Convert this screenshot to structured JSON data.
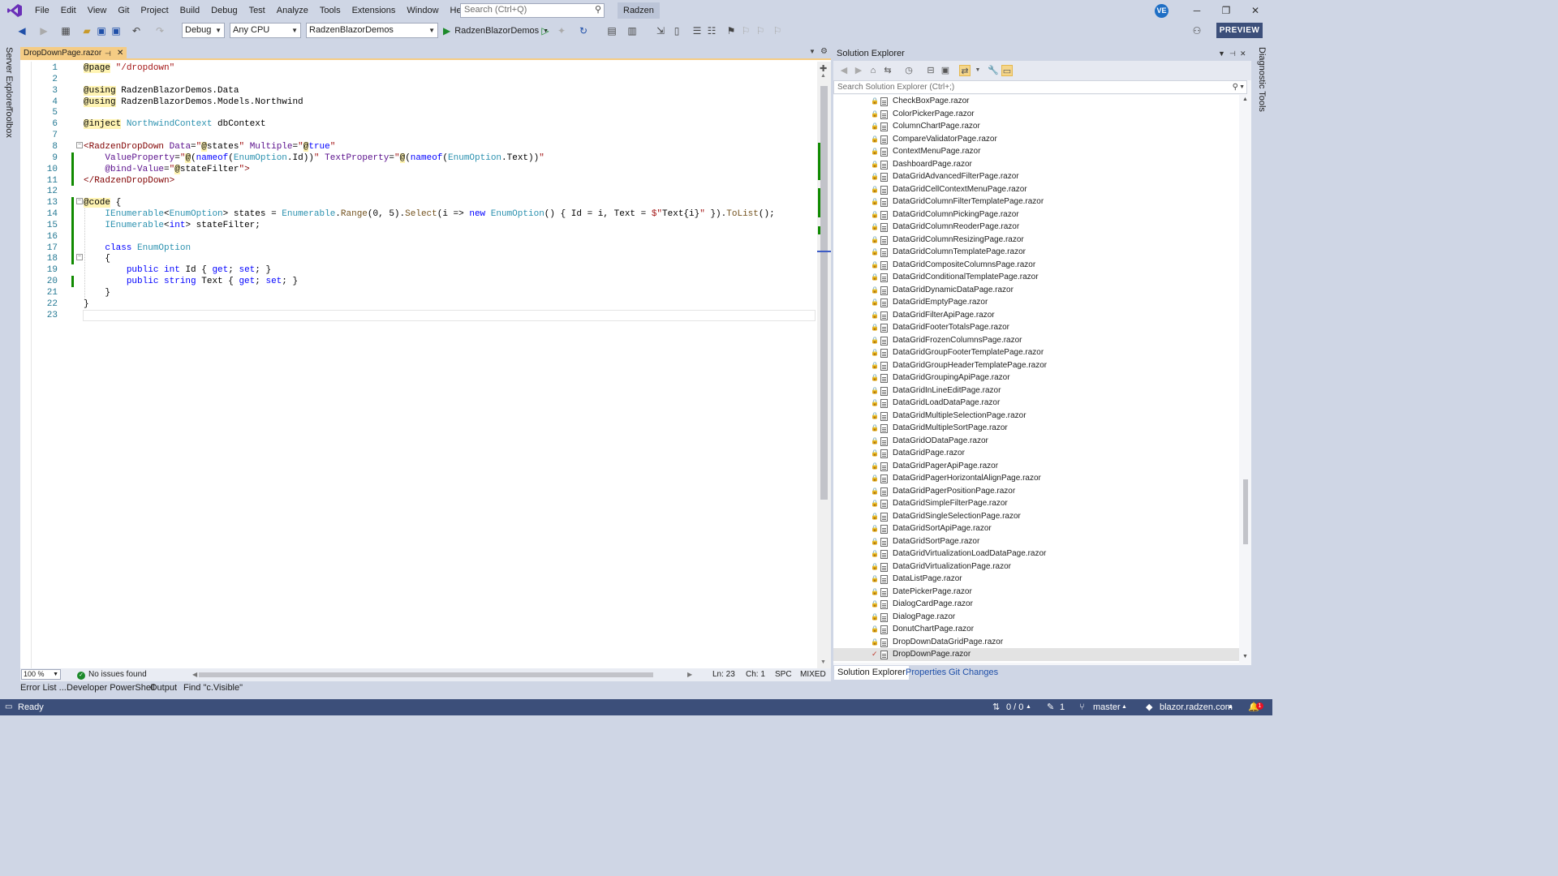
{
  "menubar": {
    "items": [
      "File",
      "Edit",
      "View",
      "Git",
      "Project",
      "Build",
      "Debug",
      "Test",
      "Analyze",
      "Tools",
      "Extensions",
      "Window",
      "Help"
    ],
    "search_placeholder": "Search (Ctrl+Q)",
    "solution_name": "Radzen",
    "user_initials": "VE"
  },
  "toolbar": {
    "configuration": "Debug",
    "platform": "Any CPU",
    "startup_project": "RadzenBlazorDemos",
    "run_label": "RadzenBlazorDemos",
    "preview_label": "PREVIEW"
  },
  "left_rail": {
    "tabs": [
      "Server Explorer",
      "Toolbox"
    ]
  },
  "right_rail": {
    "tabs": [
      "Diagnostic Tools"
    ]
  },
  "editor": {
    "tab_title": "DropDownPage.razor",
    "line_numbers": [
      "1",
      "2",
      "3",
      "4",
      "5",
      "6",
      "7",
      "8",
      "9",
      "10",
      "11",
      "12",
      "13",
      "14",
      "15",
      "16",
      "17",
      "18",
      "19",
      "20",
      "21",
      "22",
      "23"
    ],
    "lines": [
      [
        [
          "c-razor",
          "@page"
        ],
        [
          "c-plain",
          " "
        ],
        [
          "c-str",
          "\"/dropdown\""
        ]
      ],
      [],
      [
        [
          "c-razor",
          "@using"
        ],
        [
          "c-plain",
          " RadzenBlazorDemos.Data"
        ]
      ],
      [
        [
          "c-razor",
          "@using"
        ],
        [
          "c-plain",
          " RadzenBlazorDemos.Models.Northwind"
        ]
      ],
      [],
      [
        [
          "c-razor",
          "@inject"
        ],
        [
          "c-plain",
          " "
        ],
        [
          "c-type",
          "NorthwindContext"
        ],
        [
          "c-plain",
          " dbContext"
        ]
      ],
      [],
      [
        [
          "c-tag",
          "<RadzenDropDown"
        ],
        [
          "c-plain",
          " "
        ],
        [
          "c-attr",
          "Data"
        ],
        [
          "c-plain",
          "="
        ],
        [
          "c-str",
          "\""
        ],
        [
          "c-razor",
          "@"
        ],
        [
          "c-plain",
          "states"
        ],
        [
          "c-str",
          "\""
        ],
        [
          "c-plain",
          " "
        ],
        [
          "c-attr",
          "Multiple"
        ],
        [
          "c-plain",
          "="
        ],
        [
          "c-str",
          "\""
        ],
        [
          "c-razor",
          "@"
        ],
        [
          "c-kw",
          "true"
        ],
        [
          "c-str",
          "\""
        ]
      ],
      [
        [
          "c-plain",
          "    "
        ],
        [
          "c-attr",
          "ValueProperty"
        ],
        [
          "c-plain",
          "="
        ],
        [
          "c-str",
          "\""
        ],
        [
          "c-razor",
          "@"
        ],
        [
          "c-plain",
          "("
        ],
        [
          "c-kw",
          "nameof"
        ],
        [
          "c-plain",
          "("
        ],
        [
          "c-type",
          "EnumOption"
        ],
        [
          "c-plain",
          ".Id))"
        ],
        [
          "c-str",
          "\""
        ],
        [
          "c-plain",
          " "
        ],
        [
          "c-attr",
          "TextProperty"
        ],
        [
          "c-plain",
          "="
        ],
        [
          "c-str",
          "\""
        ],
        [
          "c-razor",
          "@"
        ],
        [
          "c-plain",
          "("
        ],
        [
          "c-kw",
          "nameof"
        ],
        [
          "c-plain",
          "("
        ],
        [
          "c-type",
          "EnumOption"
        ],
        [
          "c-plain",
          ".Text))"
        ],
        [
          "c-str",
          "\""
        ]
      ],
      [
        [
          "c-plain",
          "    "
        ],
        [
          "c-attr",
          "@bind-Value"
        ],
        [
          "c-plain",
          "="
        ],
        [
          "c-str",
          "\""
        ],
        [
          "c-razor",
          "@"
        ],
        [
          "c-plain",
          "stateFilter"
        ],
        [
          "c-str",
          "\""
        ],
        [
          "c-tag",
          ">"
        ]
      ],
      [
        [
          "c-tag",
          "</RadzenDropDown>"
        ]
      ],
      [],
      [
        [
          "c-razor",
          "@code"
        ],
        [
          "c-plain",
          " {"
        ]
      ],
      [
        [
          "c-plain",
          "    "
        ],
        [
          "c-type",
          "IEnumerable"
        ],
        [
          "c-plain",
          "<"
        ],
        [
          "c-type",
          "EnumOption"
        ],
        [
          "c-plain",
          "> states = "
        ],
        [
          "c-type",
          "Enumerable"
        ],
        [
          "c-plain",
          "."
        ],
        [
          "c-meth",
          "Range"
        ],
        [
          "c-plain",
          "(0, 5)."
        ],
        [
          "c-meth",
          "Select"
        ],
        [
          "c-plain",
          "(i => "
        ],
        [
          "c-kw",
          "new"
        ],
        [
          "c-plain",
          " "
        ],
        [
          "c-type",
          "EnumOption"
        ],
        [
          "c-plain",
          "() { Id = i, Text = "
        ],
        [
          "c-str",
          "$\""
        ],
        [
          "c-plain",
          "Text{i}"
        ],
        [
          "c-str",
          "\""
        ],
        [
          "c-plain",
          " })."
        ],
        [
          "c-meth",
          "ToList"
        ],
        [
          "c-plain",
          "();"
        ]
      ],
      [
        [
          "c-plain",
          "    "
        ],
        [
          "c-type",
          "IEnumerable"
        ],
        [
          "c-plain",
          "<"
        ],
        [
          "c-kw",
          "int"
        ],
        [
          "c-plain",
          "> stateFilter;"
        ]
      ],
      [],
      [
        [
          "c-plain",
          "    "
        ],
        [
          "c-kw",
          "class"
        ],
        [
          "c-plain",
          " "
        ],
        [
          "c-type",
          "EnumOption"
        ]
      ],
      [
        [
          "c-plain",
          "    {"
        ]
      ],
      [
        [
          "c-plain",
          "        "
        ],
        [
          "c-kw",
          "public"
        ],
        [
          "c-plain",
          " "
        ],
        [
          "c-kw",
          "int"
        ],
        [
          "c-plain",
          " Id { "
        ],
        [
          "c-kw",
          "get"
        ],
        [
          "c-plain",
          "; "
        ],
        [
          "c-kw",
          "set"
        ],
        [
          "c-plain",
          "; }"
        ]
      ],
      [
        [
          "c-plain",
          "        "
        ],
        [
          "c-kw",
          "public"
        ],
        [
          "c-plain",
          " "
        ],
        [
          "c-kw",
          "string"
        ],
        [
          "c-plain",
          " Text { "
        ],
        [
          "c-kw",
          "get"
        ],
        [
          "c-plain",
          "; "
        ],
        [
          "c-kw",
          "set"
        ],
        [
          "c-plain",
          "; }"
        ]
      ],
      [
        [
          "c-plain",
          "    }"
        ]
      ],
      [
        [
          "c-plain",
          "}"
        ]
      ],
      []
    ],
    "zoom": "100 %",
    "issues": "No issues found",
    "ln": "Ln: 23",
    "ch": "Ch: 1",
    "spc": "SPC",
    "eol": "MIXED"
  },
  "solution_explorer": {
    "title": "Solution Explorer",
    "search_placeholder": "Search Solution Explorer (Ctrl+;)",
    "files": [
      "CheckBoxPage.razor",
      "ColorPickerPage.razor",
      "ColumnChartPage.razor",
      "CompareValidatorPage.razor",
      "ContextMenuPage.razor",
      "DashboardPage.razor",
      "DataGridAdvancedFilterPage.razor",
      "DataGridCellContextMenuPage.razor",
      "DataGridColumnFilterTemplatePage.razor",
      "DataGridColumnPickingPage.razor",
      "DataGridColumnReoderPage.razor",
      "DataGridColumnResizingPage.razor",
      "DataGridColumnTemplatePage.razor",
      "DataGridCompositeColumnsPage.razor",
      "DataGridConditionalTemplatePage.razor",
      "DataGridDynamicDataPage.razor",
      "DataGridEmptyPage.razor",
      "DataGridFilterApiPage.razor",
      "DataGridFooterTotalsPage.razor",
      "DataGridFrozenColumnsPage.razor",
      "DataGridGroupFooterTemplatePage.razor",
      "DataGridGroupHeaderTemplatePage.razor",
      "DataGridGroupingApiPage.razor",
      "DataGridInLineEditPage.razor",
      "DataGridLoadDataPage.razor",
      "DataGridMultipleSelectionPage.razor",
      "DataGridMultipleSortPage.razor",
      "DataGridODataPage.razor",
      "DataGridPage.razor",
      "DataGridPagerApiPage.razor",
      "DataGridPagerHorizontalAlignPage.razor",
      "DataGridPagerPositionPage.razor",
      "DataGridSimpleFilterPage.razor",
      "DataGridSingleSelectionPage.razor",
      "DataGridSortApiPage.razor",
      "DataGridSortPage.razor",
      "DataGridVirtualizationLoadDataPage.razor",
      "DataGridVirtualizationPage.razor",
      "DataListPage.razor",
      "DatePickerPage.razor",
      "DialogCardPage.razor",
      "DialogPage.razor",
      "DonutChartPage.razor",
      "DropDownDataGridPage.razor",
      "DropDownPage.razor"
    ],
    "selected_file": "DropDownPage.razor",
    "tabs": [
      "Solution Explorer",
      "Properties",
      "Git Changes"
    ]
  },
  "bottom_tabs": [
    "Error List ...",
    "Developer PowerShell",
    "Output",
    "Find \"c.Visible\""
  ],
  "statusbar": {
    "ready": "Ready",
    "changes": "0 / 0",
    "pending": "1",
    "branch": "master",
    "repo": "blazor.radzen.com",
    "notifications": "1"
  }
}
